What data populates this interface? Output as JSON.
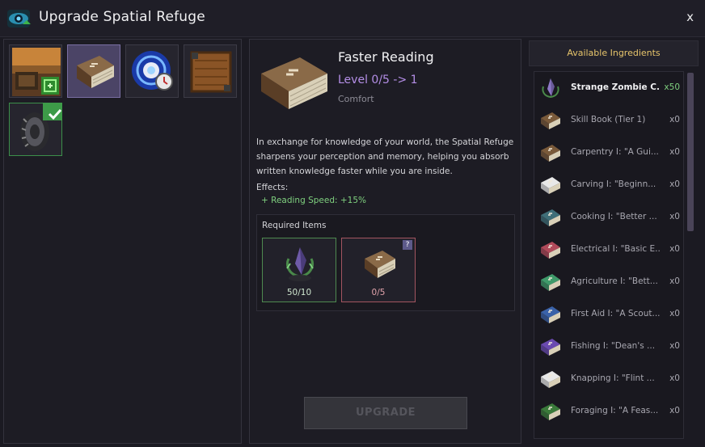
{
  "window": {
    "title": "Upgrade Spatial Refuge",
    "close_label": "x",
    "icon": "refuge-eye-icon"
  },
  "upgrades": [
    {
      "icon": "landscape-upgrade-icon",
      "selected": false,
      "completed": false
    },
    {
      "icon": "book-icon",
      "selected": true,
      "completed": false
    },
    {
      "icon": "portal-clock-icon",
      "selected": false,
      "completed": false
    },
    {
      "icon": "wooden-crate-icon",
      "selected": false,
      "completed": false
    },
    {
      "icon": "tire-icon",
      "selected": false,
      "completed": true
    }
  ],
  "detail": {
    "name": "Faster Reading",
    "level": "Level 0/5 -> 1",
    "category": "Comfort",
    "description": "In exchange for knowledge of your world, the Spatial Refuge sharpens your perception and memory, helping you absorb written knowledge faster while you are inside.",
    "effects_label": "Effects:",
    "effect": "+ Reading Speed: +15%",
    "required_label": "Required Items",
    "required": [
      {
        "icon": "zombie-crystal-icon",
        "count": "50/10",
        "satisfied": true
      },
      {
        "icon": "book-icon",
        "count": "0/5",
        "satisfied": false,
        "badge": "?"
      }
    ],
    "upgrade_button": "UPGRADE"
  },
  "ingredients": {
    "header": "Available Ingredients",
    "items": [
      {
        "name": "Strange Zombie C...",
        "qty": "x50",
        "color": "#6a5a9a",
        "icon": "zombie-crystal-icon"
      },
      {
        "name": "Skill Book (Tier 1)",
        "qty": "x0",
        "color": "#7a5a3a",
        "icon": "book-icon"
      },
      {
        "name": "Carpentry I: \"A Gui...",
        "qty": "x0",
        "color": "#7a5a3a",
        "icon": "book-icon"
      },
      {
        "name": "Carving I: \"Beginn...",
        "qty": "x0",
        "color": "#e8e8e8",
        "icon": "book-icon"
      },
      {
        "name": "Cooking I: \"Better ...",
        "qty": "x0",
        "color": "#3f6e78",
        "icon": "book-icon"
      },
      {
        "name": "Electrical I: \"Basic E...",
        "qty": "x0",
        "color": "#b04a5a",
        "icon": "book-icon"
      },
      {
        "name": "Agriculture I: \"Bett...",
        "qty": "x0",
        "color": "#3f9a6a",
        "icon": "book-icon"
      },
      {
        "name": "First Aid I: \"A Scout...",
        "qty": "x0",
        "color": "#3a62a8",
        "icon": "book-icon"
      },
      {
        "name": "Fishing I: \"Dean's ...",
        "qty": "x0",
        "color": "#6a4ab0",
        "icon": "book-icon"
      },
      {
        "name": "Knapping I: \"Flint ...",
        "qty": "x0",
        "color": "#e8e8e8",
        "icon": "book-icon"
      },
      {
        "name": "Foraging I: \"A Feas...",
        "qty": "x0",
        "color": "#3a7a3a",
        "icon": "book-icon"
      }
    ]
  }
}
